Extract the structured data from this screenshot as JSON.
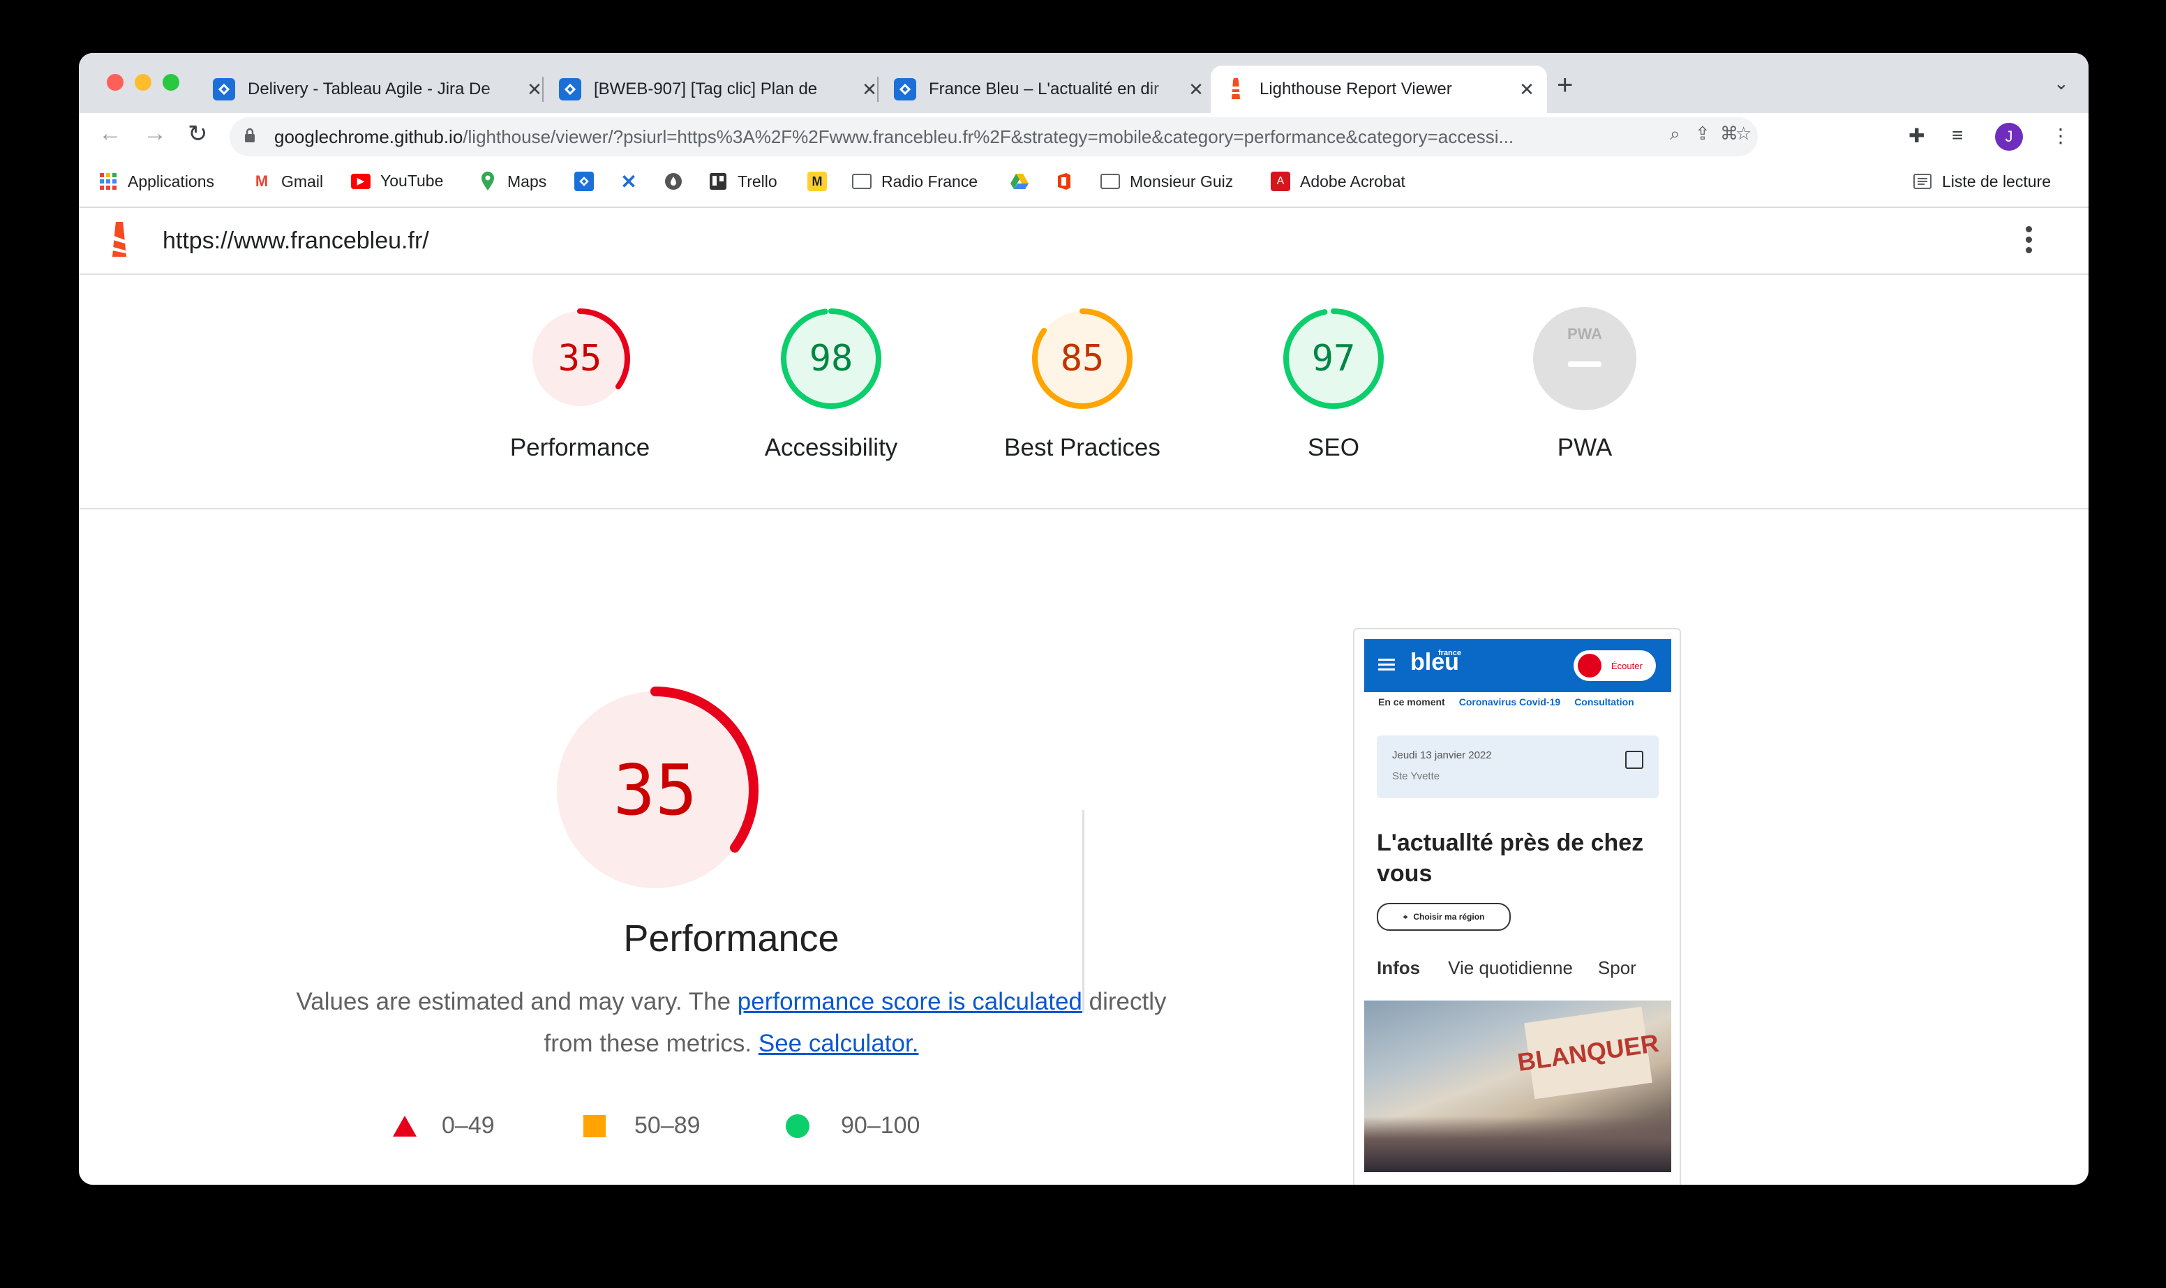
{
  "browser": {
    "tabs": [
      {
        "title": "Delivery - Tableau Agile - Jira De"
      },
      {
        "title": "[BWEB-907] [Tag clic] Plan de"
      },
      {
        "title": "France Bleu – L'actualité en dir"
      },
      {
        "title": "Lighthouse Report Viewer"
      }
    ],
    "url_host": "googlechrome.github.io",
    "url_rest": "/lighthouse/viewer/?psiurl=https%3A%2F%2Fwww.francebleu.fr%2F&strategy=mobile&category=performance&category=accessi...",
    "avatar_letter": "J",
    "bookmarks": [
      {
        "label": "Applications",
        "icon": "apps-grid-icon"
      },
      {
        "label": "Gmail",
        "icon": "gmail-icon"
      },
      {
        "label": "YouTube",
        "icon": "youtube-icon"
      },
      {
        "label": "Maps",
        "icon": "maps-icon"
      },
      {
        "label": "Trello",
        "icon": "trello-icon"
      },
      {
        "label": "Radio France",
        "icon": "folder-icon"
      },
      {
        "label": "Monsieur Guiz",
        "icon": "folder-icon"
      },
      {
        "label": "Adobe Acrobat",
        "icon": "acrobat-icon"
      }
    ],
    "reading_list": "Liste de lecture"
  },
  "report": {
    "url": "https://www.francebleu.fr/",
    "gauges": [
      {
        "score": "35",
        "label": "Performance",
        "value": 0.35,
        "color": "#e8001b",
        "bg": "#fdecec"
      },
      {
        "score": "98",
        "label": "Accessibility",
        "value": 0.98,
        "color": "#0cce6b",
        "bg": "#e6f9ef"
      },
      {
        "score": "85",
        "label": "Best Practices",
        "value": 0.85,
        "color": "#ffa400",
        "bg": "#fff5e6"
      },
      {
        "score": "97",
        "label": "SEO",
        "value": 0.97,
        "color": "#0cce6b",
        "bg": "#e6f9ef"
      },
      {
        "score": "",
        "label": "PWA",
        "value": 0,
        "color": "#9e9e9e",
        "bg": "#e0e0e0"
      }
    ],
    "pwa_badge": "PWA",
    "main_score": "35",
    "main_value": 0.35,
    "main_title": "Performance",
    "desc_1": "Values are estimated and may vary. The ",
    "desc_link_1": "performance score is calculated",
    "desc_2": " directly from these metrics. ",
    "desc_link_2": "See calculator.",
    "legend": [
      {
        "range": "0–49"
      },
      {
        "range": "50–89"
      },
      {
        "range": "90–100"
      }
    ]
  },
  "thumbnail": {
    "logo": "bleu",
    "logo_small": "france",
    "listen": "Écouter",
    "sub_nav": [
      "En ce moment",
      "Coronavirus Covid-19",
      "Consultation"
    ],
    "date": "Jeudi 13 janvier 2022",
    "saint": "Ste Yvette",
    "headline": "L'actuallté près de chez vous",
    "region_btn": "Choisir ma région",
    "tabs": [
      "Infos",
      "Vie quotidienne",
      "Spor"
    ],
    "sign_text": "BLANQUER"
  }
}
